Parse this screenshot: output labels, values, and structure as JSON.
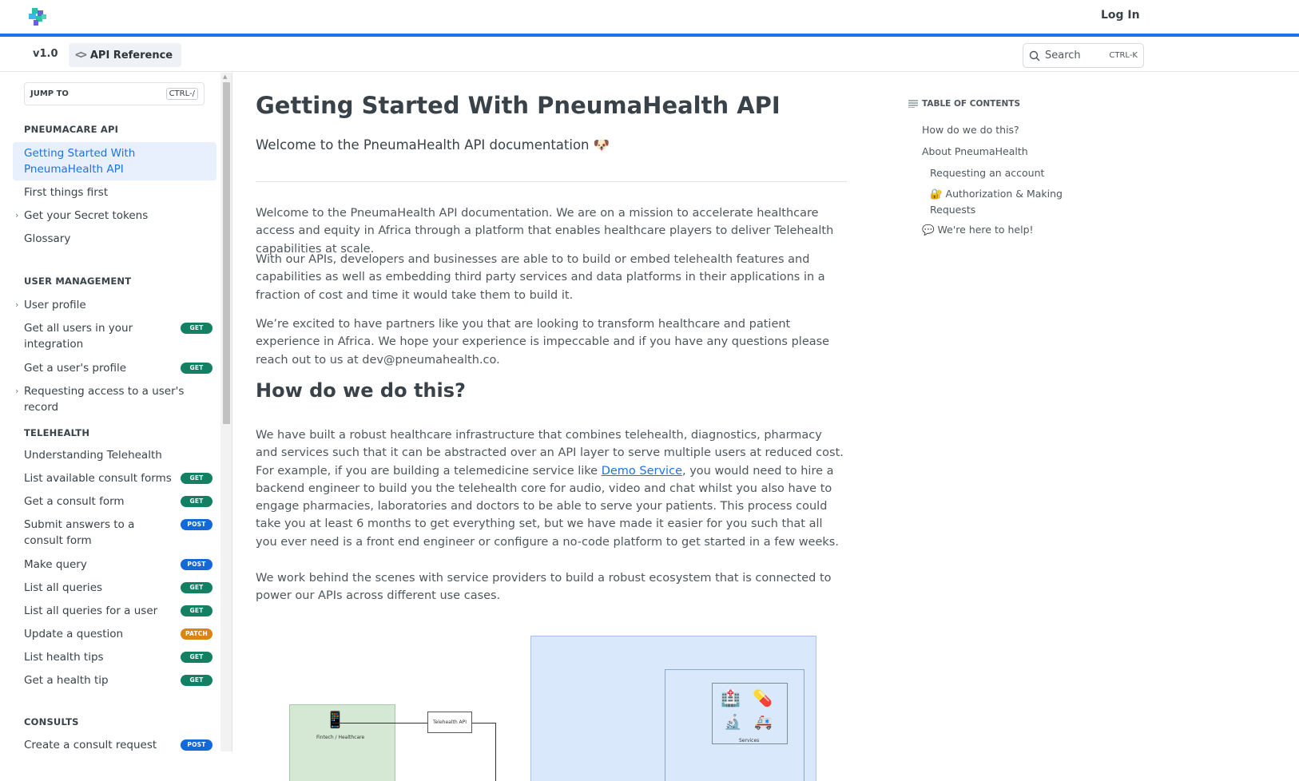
{
  "header": {
    "login_label": "Log In"
  },
  "subnav": {
    "version": "v1.0",
    "api_reference": "API Reference",
    "search_label": "Search",
    "search_shortcut": "CTRL-K"
  },
  "sidebar": {
    "jump_to": "JUMP TO",
    "jump_shortcut": "CTRL-/",
    "sections": [
      {
        "title": "PNEUMACARE API"
      },
      {
        "title": "USER MANAGEMENT"
      },
      {
        "title": "TELEHEALTH"
      },
      {
        "title": "CONSULTS"
      }
    ],
    "items": [
      {
        "label": "Getting Started With PneumaHealth API"
      },
      {
        "label": "First things first"
      },
      {
        "label": "Get your Secret tokens"
      },
      {
        "label": "Glossary"
      },
      {
        "label": "User profile"
      },
      {
        "label": "Get all users in your integration",
        "method": "GET"
      },
      {
        "label": "Get a user's profile",
        "method": "GET"
      },
      {
        "label": "Requesting access to a user's record"
      },
      {
        "label": "Understanding Telehealth"
      },
      {
        "label": "List available consult forms",
        "method": "GET"
      },
      {
        "label": "Get a consult form",
        "method": "GET"
      },
      {
        "label": "Submit answers to a consult form",
        "method": "POST"
      },
      {
        "label": "Make query",
        "method": "POST"
      },
      {
        "label": "List all queries",
        "method": "GET"
      },
      {
        "label": "List all queries for a user",
        "method": "GET"
      },
      {
        "label": "Update a question",
        "method": "PATCH"
      },
      {
        "label": "List health tips",
        "method": "GET"
      },
      {
        "label": "Get a health tip",
        "method": "GET"
      },
      {
        "label": "Create a consult request",
        "method": "POST"
      }
    ]
  },
  "main": {
    "title": "Getting Started With PneumaHealth API",
    "subtitle": "Welcome to the PneumaHealth API documentation 🐶",
    "paragraphs": [
      "Welcome to the PneumaHealth API documentation. We are on a mission to accelerate healthcare access and equity in Africa through a platform that enables healthcare players to deliver Telehealth capabilities at scale.",
      "With our APIs, developers and businesses are able to to build or embed telehealth features and capabilities as well as embedding third party services and data platforms in their applications in a fraction of cost and time it would take them to build it.",
      "We’re excited to have partners like you that are looking to transform healthcare and patient experience in Africa. We hope your experience is impeccable and if you have any questions please reach out to us at dev@pneumahealth.co."
    ],
    "how_heading": "How do we do this?",
    "how_para_before_link": "We have built a robust healthcare infrastructure that combines telehealth, diagnostics, pharmacy and services such that it can be abstracted over an API layer to serve multiple users at reduced cost. For example, if you are building a telemedicine service like ",
    "how_link": "Demo Service",
    "how_para_after_link": ", you would need to hire a backend engineer to build you the telehealth core for audio, video and chat whilst you also have to engage pharmacies, laboratories and doctors to be able to serve your patients. This process could take you at least 6 months to get everything set, but we have made it easier for you such that all you ever need is a front end engineer or configure a no-code platform to get started in a few weeks.",
    "how_para2": "We work behind the scenes with service providers to build a robust ecosystem that is connected to power our APIs across different use cases.",
    "diagram": {
      "green_label": "Fintech / Healthcare",
      "api_label": "Telehealth API",
      "services_label": "Services"
    }
  },
  "toc": {
    "title": "TABLE OF CONTENTS",
    "items": [
      {
        "label": "How do we do this?"
      },
      {
        "label": "About PneumaHealth"
      },
      {
        "label": "Requesting an account"
      },
      {
        "label": "🔐 Authorization & Making Requests"
      },
      {
        "label": "💬 We're here to help!"
      }
    ]
  },
  "colors": {
    "accent": "#1a73e8",
    "get": "#138064",
    "post": "#1369d8",
    "patch": "#d98512"
  }
}
